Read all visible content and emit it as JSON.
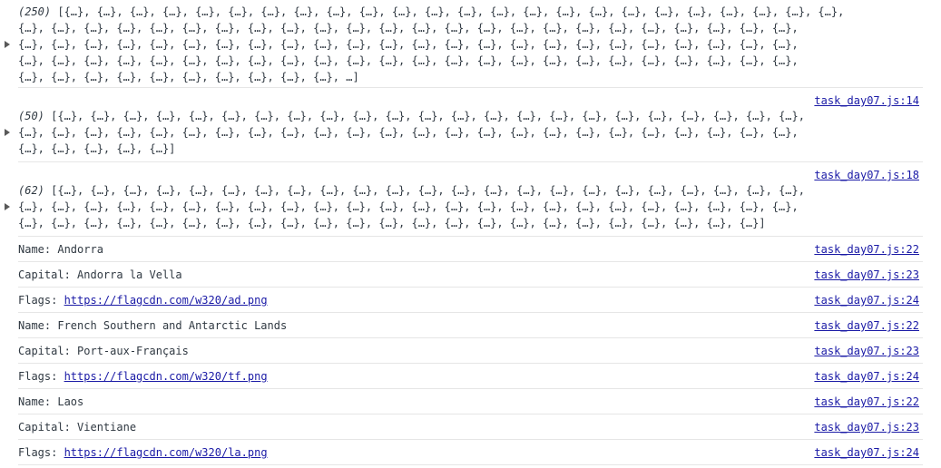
{
  "arrays": [
    {
      "count_label": "(250)",
      "line1": "[{…}, {…}, {…}, {…}, {…}, {…}, {…}, {…}, {…}, {…}, {…}, {…}, {…}, {…}, {…}, {…}, {…}, {…}, {…}, {…}, {…}, {…}, {…}, {…},",
      "line2": "{…}, {…}, {…}, {…}, {…}, {…}, {…}, {…}, {…}, {…}, {…}, {…}, {…}, {…}, {…}, {…}, {…}, {…}, {…}, {…}, {…}, {…}, {…}, {…},",
      "line3": "{…}, {…}, {…}, {…}, {…}, {…}, {…}, {…}, {…}, {…}, {…}, {…}, {…}, {…}, {…}, {…}, {…}, {…}, {…}, {…}, {…}, {…}, {…}, {…},",
      "line4": "{…}, {…}, {…}, {…}, {…}, {…}, {…}, {…}, {…}, {…}, {…}, {…}, {…}, {…}, {…}, {…}, {…}, {…}, {…}, {…}, {…}, {…}, {…}, {…},",
      "line5": "{…}, {…}, {…}, {…}, {…}, {…}, {…}, {…}, {…}, {…}, …]",
      "source": ""
    },
    {
      "count_label": "(50)",
      "line1": "[{…}, {…}, {…}, {…}, {…}, {…}, {…}, {…}, {…}, {…}, {…}, {…}, {…}, {…}, {…}, {…}, {…}, {…}, {…}, {…}, {…}, {…}, {…},",
      "line2": "{…}, {…}, {…}, {…}, {…}, {…}, {…}, {…}, {…}, {…}, {…}, {…}, {…}, {…}, {…}, {…}, {…}, {…}, {…}, {…}, {…}, {…}, {…}, {…},",
      "line3": "{…}, {…}, {…}, {…}, {…}]",
      "source": "task_day07.js:14"
    },
    {
      "count_label": "(62)",
      "line1": "[{…}, {…}, {…}, {…}, {…}, {…}, {…}, {…}, {…}, {…}, {…}, {…}, {…}, {…}, {…}, {…}, {…}, {…}, {…}, {…}, {…}, {…}, {…},",
      "line2": "{…}, {…}, {…}, {…}, {…}, {…}, {…}, {…}, {…}, {…}, {…}, {…}, {…}, {…}, {…}, {…}, {…}, {…}, {…}, {…}, {…}, {…}, {…}, {…},",
      "line3": "{…}, {…}, {…}, {…}, {…}, {…}, {…}, {…}, {…}, {…}, {…}, {…}, {…}, {…}, {…}, {…}, {…}, {…}, {…}, {…}, {…}, {…}, {…}]",
      "source": "task_day07.js:18"
    }
  ],
  "logs": [
    {
      "prefix": "Name: Andorra",
      "link": "",
      "source": "task_day07.js:22"
    },
    {
      "prefix": "Capital: Andorra la Vella",
      "link": "",
      "source": "task_day07.js:23"
    },
    {
      "prefix": "Flags: ",
      "link": "https://flagcdn.com/w320/ad.png",
      "source": "task_day07.js:24"
    },
    {
      "prefix": "Name: French Southern and Antarctic Lands",
      "link": "",
      "source": "task_day07.js:22"
    },
    {
      "prefix": "Capital: Port-aux-Français",
      "link": "",
      "source": "task_day07.js:23"
    },
    {
      "prefix": "Flags: ",
      "link": "https://flagcdn.com/w320/tf.png",
      "source": "task_day07.js:24"
    },
    {
      "prefix": "Name: Laos",
      "link": "",
      "source": "task_day07.js:22"
    },
    {
      "prefix": "Capital: Vientiane",
      "link": "",
      "source": "task_day07.js:23"
    },
    {
      "prefix": "Flags: ",
      "link": "https://flagcdn.com/w320/la.png",
      "source": "task_day07.js:24"
    }
  ],
  "colors": {
    "link": "#1a1aa6",
    "text": "#303942",
    "divider": "#e6e6e6"
  }
}
